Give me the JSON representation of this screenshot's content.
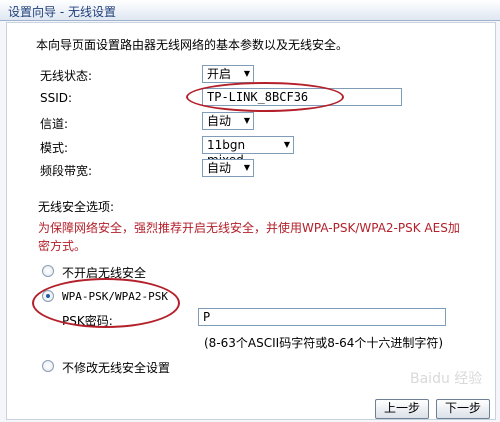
{
  "window": {
    "title": "设置向导 - 无线设置"
  },
  "intro": "本向导页面设置路由器无线网络的基本参数以及无线安全。",
  "fields": {
    "wireless_status": {
      "label": "无线状态:",
      "value": "开启"
    },
    "ssid": {
      "label": "SSID:",
      "value": "TP-LINK_8BCF36"
    },
    "channel": {
      "label": "信道:",
      "value": "自动"
    },
    "mode": {
      "label": "模式:",
      "value": "11bgn mixed"
    },
    "bandwidth": {
      "label": "频段带宽:",
      "value": "自动"
    }
  },
  "security": {
    "heading": "无线安全选项:",
    "warning": "为保障网络安全，强烈推荐开启无线安全，并使用WPA-PSK/WPA2-PSK AES加密方式。",
    "options": [
      {
        "label": "不开启无线安全",
        "selected": false
      },
      {
        "label": "WPA-PSK/WPA2-PSK",
        "selected": true
      },
      {
        "label": "不修改无线安全设置",
        "selected": false
      }
    ],
    "psk_label": "PSK密码:",
    "psk_value": "P",
    "psk_hint": "(8-63个ASCII码字符或8-64个十六进制字符)"
  },
  "buttons": {
    "prev": "上一步",
    "next": "下一步"
  },
  "watermark": "Baidu 经验",
  "colors": {
    "annotation_ellipse": "#b3202a",
    "warning_text": "#b3202a"
  }
}
